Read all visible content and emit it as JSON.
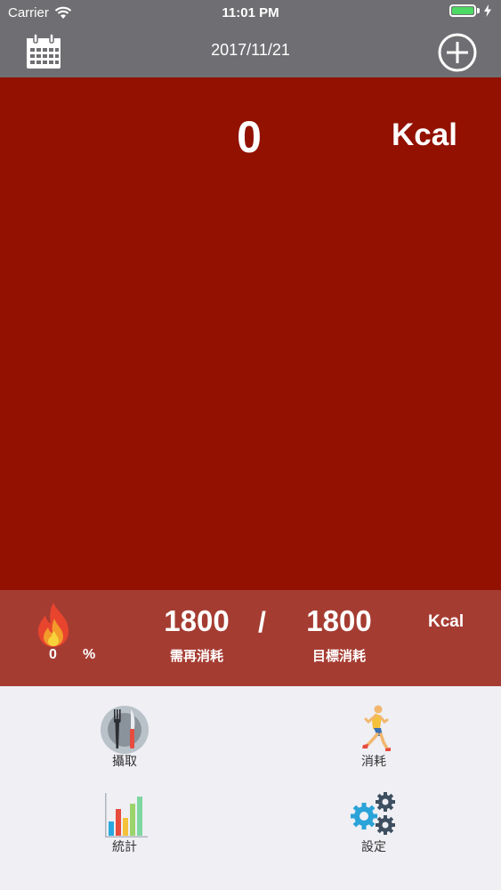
{
  "status_bar": {
    "carrier": "Carrier",
    "time": "11:01 PM",
    "wifi_icon": "wifi-icon",
    "battery_icon": "battery-icon",
    "charging_icon": "charging-bolt-icon",
    "battery_color": "#4cd964"
  },
  "nav": {
    "title": "2017/11/21",
    "left_icon": "calendar-icon",
    "right_icon": "add-circle-icon"
  },
  "main": {
    "kcal_value": "0",
    "kcal_unit": "Kcal",
    "background": "#921100"
  },
  "summary": {
    "flame_icon": "flame-icon",
    "percent_value": "0",
    "percent_unit": "%",
    "remaining_value": "1800",
    "remaining_label": "需再消耗",
    "separator": "/",
    "target_value": "1800",
    "target_label": "目標消耗",
    "unit": "Kcal",
    "background": "#a53c32"
  },
  "menu": {
    "items": [
      {
        "label": "攝取",
        "icon": "fork-knife-plate-icon"
      },
      {
        "label": "消耗",
        "icon": "runner-icon"
      },
      {
        "label": "統計",
        "icon": "bar-chart-icon"
      },
      {
        "label": "設定",
        "icon": "gears-icon"
      }
    ]
  }
}
